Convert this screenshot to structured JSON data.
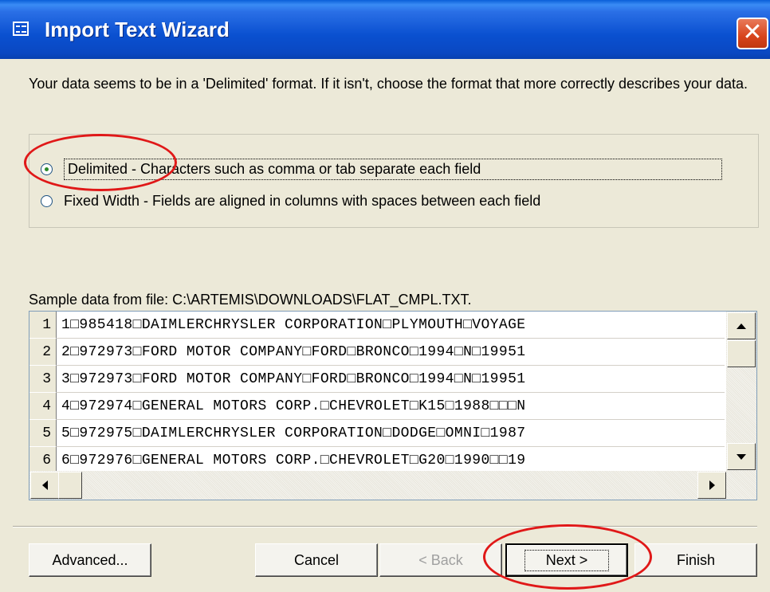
{
  "window": {
    "title": "Import Text Wizard",
    "close": "✕"
  },
  "intro": "Your data seems to be in a 'Delimited' format. If it isn't, choose the format that more correctly describes your data.",
  "options": [
    {
      "label": "Delimited - Characters such as comma or tab separate each field",
      "checked": true
    },
    {
      "label": "Fixed Width - Fields are aligned in columns with spaces between each field",
      "checked": false
    }
  ],
  "sample_label": "Sample data from file: C:\\ARTEMIS\\DOWNLOADS\\FLAT_CMPL.TXT.",
  "rows": [
    {
      "num": "1",
      "text": "1□985418□DAIMLERCHRYSLER CORPORATION□PLYMOUTH□VOYAGE"
    },
    {
      "num": "2",
      "text": "2□972973□FORD MOTOR COMPANY□FORD□BRONCO□1994□N□19951"
    },
    {
      "num": "3",
      "text": "3□972973□FORD MOTOR COMPANY□FORD□BRONCO□1994□N□19951"
    },
    {
      "num": "4",
      "text": "4□972974□GENERAL MOTORS CORP.□CHEVROLET□K15□1988□□□N"
    },
    {
      "num": "5",
      "text": "5□972975□DAIMLERCHRYSLER CORPORATION□DODGE□OMNI□1987"
    },
    {
      "num": "6",
      "text": "6□972976□GENERAL MOTORS CORP.□CHEVROLET□G20□1990□□19"
    }
  ],
  "buttons": {
    "advanced": "Advanced...",
    "cancel": "Cancel",
    "back": "< Back",
    "next": "Next >",
    "finish": "Finish"
  },
  "colors": {
    "title_bar": "#0a50d0",
    "close": "#d8441c",
    "highlight_ring": "#e01818",
    "face": "#ece9d8"
  },
  "icons": {
    "title": "table-icon",
    "close": "close-icon"
  }
}
